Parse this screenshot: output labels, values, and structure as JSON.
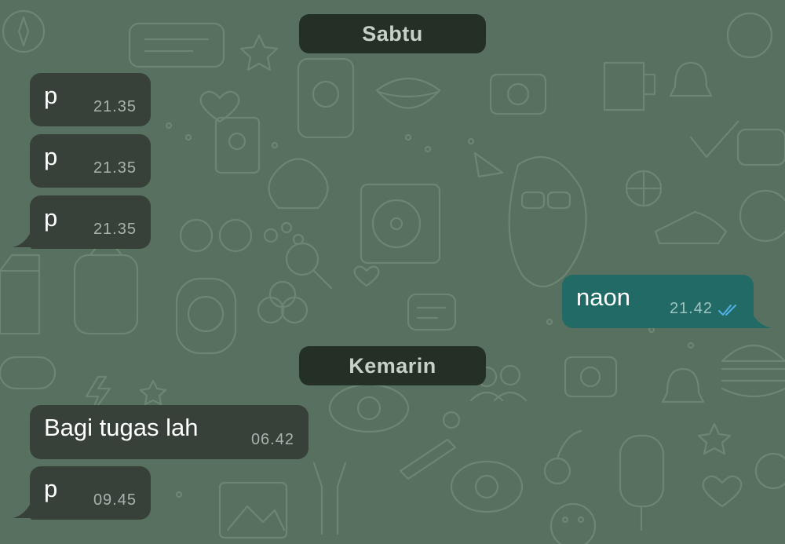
{
  "colors": {
    "wallpaper": "#58705f",
    "incoming_bubble": "#37413a",
    "outgoing_bubble": "#226a66",
    "date_chip": "#243026",
    "read_ticks": "#4fb3e8"
  },
  "sections": [
    {
      "date_label": "Sabtu",
      "messages": [
        {
          "direction": "in",
          "text": "p",
          "time": "21.35"
        },
        {
          "direction": "in",
          "text": "p",
          "time": "21.35"
        },
        {
          "direction": "in",
          "text": "p",
          "time": "21.35"
        },
        {
          "direction": "out",
          "text": "naon",
          "time": "21.42",
          "status": "read-double-check-icon"
        }
      ]
    },
    {
      "date_label": "Kemarin",
      "messages": [
        {
          "direction": "in",
          "text": "Bagi tugas lah",
          "time": "06.42"
        },
        {
          "direction": "in",
          "text": "p",
          "time": "09.45"
        }
      ]
    }
  ]
}
